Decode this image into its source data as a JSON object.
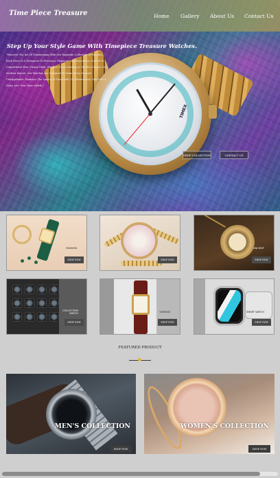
{
  "navbar": {
    "brand": "Time Piece Treasure",
    "links": [
      "Home",
      "Gallery",
      "About Us",
      "Contact Us"
    ]
  },
  "hero": {
    "title": "Step Up Your Style Game With Timepiece Treasure Watches.",
    "text": "\"Discover The Art Of Timekeeping With Our Exquisite Collection Of Watches, Each Piece Is A Testament To Precision, Elegance, And Innovation. Crafted To Complement Your Unique Style, Whether You're Seeking A Timeless Classic Or A Modern Marvel, Our Watches Are Designed To Make Every Moment Unforgettable. Embrace The Luxury Of Time With Us, Where Every Tick Tells A Story. Live Your Time Stylish.\"",
    "buttons": [
      "SHOP COLLECTION",
      "CONTACT US"
    ],
    "dial_brand": "TIMEX"
  },
  "products": [
    {
      "label": "FASHION",
      "button": "SHOP NOW"
    },
    {
      "label": "",
      "button": "SHOP NOW"
    },
    {
      "label": "ANCIENT",
      "button": "SHOP NOW"
    },
    {
      "label": "COLLECTION WATCH",
      "button": "SHOP NOW"
    },
    {
      "label": "VINTAGE",
      "button": "SHOP NOW"
    },
    {
      "label": "SMART WATCH",
      "button": "SHOP NOW"
    }
  ],
  "featured": {
    "title": "FEATURED PRODUCT",
    "accent": "#e5b73b",
    "items": [
      {
        "label": "MEN'S COLLECTION",
        "button": "SHOP NOW"
      },
      {
        "label": "WOMEN'S COLLECTION",
        "button": "SHOP NOW"
      }
    ]
  }
}
